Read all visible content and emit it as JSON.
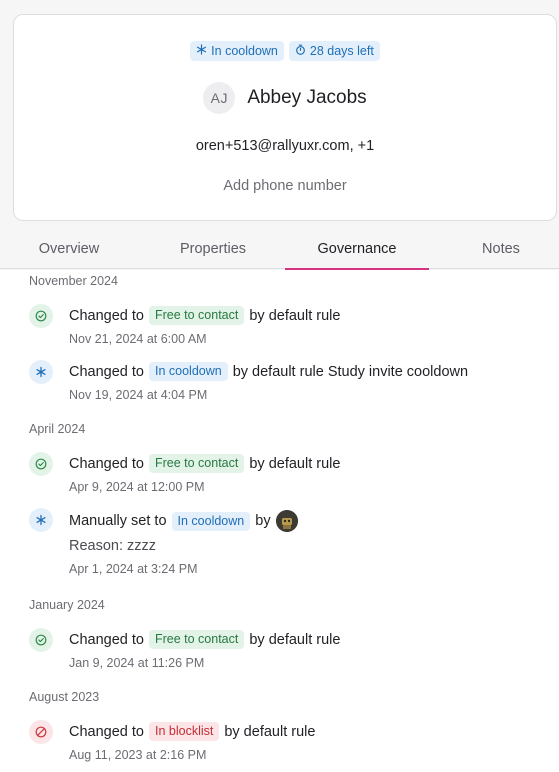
{
  "profile": {
    "status_badge": "In cooldown",
    "days_badge": "28 days left",
    "initials": "AJ",
    "name": "Abbey Jacobs",
    "email": "oren+513@rallyuxr.com, +1",
    "add_phone": "Add phone number"
  },
  "tabs": [
    "Overview",
    "Properties",
    "Governance",
    "Notes"
  ],
  "active_tab": "Governance",
  "colors": {
    "accent": "#d63384",
    "cooldown_bg": "#e3effa",
    "cooldown_fg": "#1f6fb8",
    "free_bg": "#e3f3e8",
    "free_fg": "#277a40",
    "blocklist_bg": "#fbe5e6",
    "blocklist_fg": "#c52c36"
  },
  "timeline": {
    "sections": [
      {
        "title": "November 2024",
        "events": [
          {
            "icon": "check-circle-icon",
            "prefix": "Changed to",
            "tag": "Free to contact",
            "suffix": "by default rule",
            "time": "Nov 21, 2024 at 6:00 AM"
          },
          {
            "icon": "snowflake-icon",
            "prefix": "Changed to",
            "tag": "In cooldown",
            "suffix": "by default rule Study invite cooldown",
            "time": "Nov 19, 2024 at 4:04 PM"
          }
        ]
      },
      {
        "title": "April 2024",
        "events": [
          {
            "icon": "check-circle-icon",
            "prefix": "Changed to",
            "tag": "Free to contact",
            "suffix": "by default rule",
            "time": "Apr 9, 2024 at 12:00 PM"
          },
          {
            "icon": "snowflake-icon",
            "prefix": "Manually set to",
            "tag": "In cooldown",
            "suffix": "by",
            "reason": "Reason: zzzz",
            "time": "Apr 1, 2024 at 3:24 PM"
          }
        ]
      },
      {
        "title": "January 2024",
        "events": [
          {
            "icon": "check-circle-icon",
            "prefix": "Changed to",
            "tag": "Free to contact",
            "suffix": "by default rule",
            "time": "Jan 9, 2024 at 11:26 PM"
          }
        ]
      },
      {
        "title": "August 2023",
        "events": [
          {
            "icon": "blocked-circle-icon",
            "prefix": "Changed to",
            "tag": "In blocklist",
            "suffix": "by default rule",
            "time": "Aug 11, 2023 at 2:16 PM"
          }
        ]
      }
    ]
  }
}
